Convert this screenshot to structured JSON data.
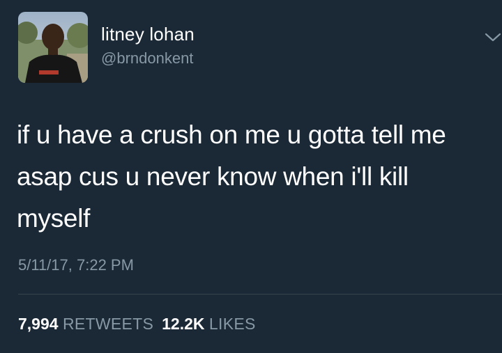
{
  "user": {
    "display_name": "litney lohan",
    "handle": "@brndonkent"
  },
  "tweet": {
    "lines": [
      "if u have a crush on me u gotta tell me",
      "asap cus u never know when i'll kill",
      "myself"
    ],
    "timestamp": "5/11/17, 7:22 PM"
  },
  "stats": {
    "retweets_count": "7,994",
    "retweets_label": "RETWEETS",
    "likes_count": "12.2K",
    "likes_label": "LIKES"
  },
  "icons": {
    "menu": "chevron-down-icon"
  },
  "colors": {
    "background": "#1b2836",
    "primary_text": "#ffffff",
    "secondary_text": "#8899a6",
    "divider": "#38444d"
  }
}
